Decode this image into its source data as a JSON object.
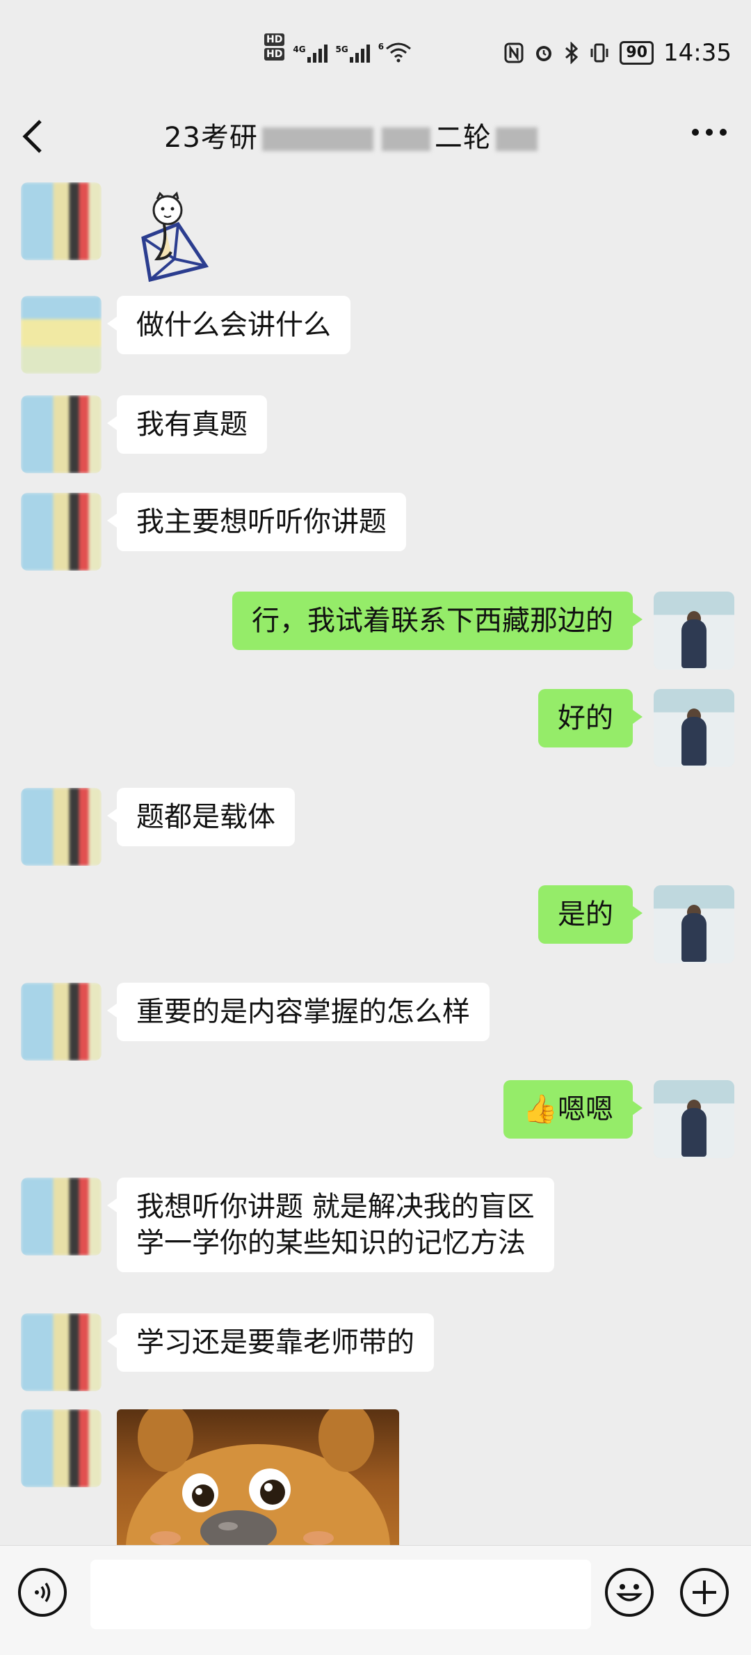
{
  "status_bar": {
    "network_badges": [
      "HD",
      "HD"
    ],
    "signal1_label": "4G",
    "signal2_label": "5G",
    "wifi_label": "6",
    "battery_level": "90",
    "time": "14:35"
  },
  "header": {
    "title_prefix": "23考研",
    "title_mid": "二轮",
    "back_icon": "chevron-left-icon",
    "more_icon": "more-dots-icon"
  },
  "messages": [
    {
      "side": "in",
      "type": "sticker",
      "sticker": "cat-cube"
    },
    {
      "side": "in",
      "type": "text",
      "text": "做什么会讲什么"
    },
    {
      "side": "in",
      "type": "text",
      "text": "我有真题"
    },
    {
      "side": "in",
      "type": "text",
      "text": "我主要想听听你讲题"
    },
    {
      "side": "out",
      "type": "text",
      "text": "行，我试着联系下西藏那边的"
    },
    {
      "side": "out",
      "type": "text",
      "text": "好的"
    },
    {
      "side": "in",
      "type": "text",
      "text": "题都是载体"
    },
    {
      "side": "out",
      "type": "text",
      "text": "是的"
    },
    {
      "side": "in",
      "type": "text",
      "text": "重要的是内容掌握的怎么样"
    },
    {
      "side": "out",
      "type": "text",
      "text": "嗯嗯",
      "emoji": "👍"
    },
    {
      "side": "in",
      "type": "text",
      "text": "我想听你讲题 就是解决我的盲区\n学一学你的某些知识的记忆方法"
    },
    {
      "side": "in",
      "type": "text",
      "text": "学习还是要靠老师带的"
    },
    {
      "side": "in",
      "type": "sticker",
      "sticker": "bear"
    }
  ],
  "input_bar": {
    "voice_icon": "voice-icon",
    "emoji_icon": "emoji-icon",
    "plus_icon": "plus-icon"
  }
}
